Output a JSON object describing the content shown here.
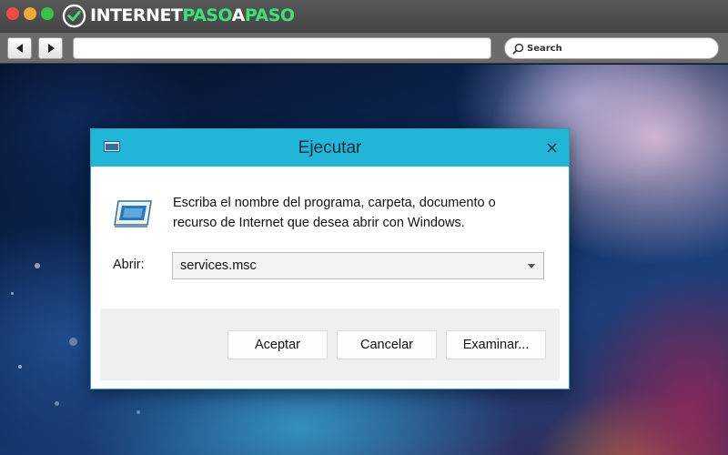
{
  "browser": {
    "logo": {
      "part1": "INTERNET",
      "part2": "PASO",
      "part3": "A",
      "part4": "PASO",
      "icon": "logo-mark-icon",
      "accent_color": "#3ee07a"
    },
    "traffic_lights": [
      "#ee4d45",
      "#f3a83b",
      "#37c14a"
    ],
    "nav": {
      "back_icon": "triangle-left-icon",
      "forward_icon": "triangle-right-icon"
    },
    "url": {
      "value": ""
    },
    "search": {
      "label": "Search",
      "icon": "search-icon"
    }
  },
  "dialog": {
    "title": "Ejecutar",
    "title_icon": "run-window-icon",
    "close_icon": "close-icon",
    "titlebar_color": "#21b5d8",
    "description_line1": "Escriba el nombre del programa, carpeta, documento o",
    "description_line2": "recurso de Internet que desea abrir con Windows.",
    "open_label": "Abrir:",
    "open_value": "services.msc",
    "buttons": {
      "ok": "Aceptar",
      "cancel": "Cancelar",
      "browse": "Examinar..."
    }
  }
}
